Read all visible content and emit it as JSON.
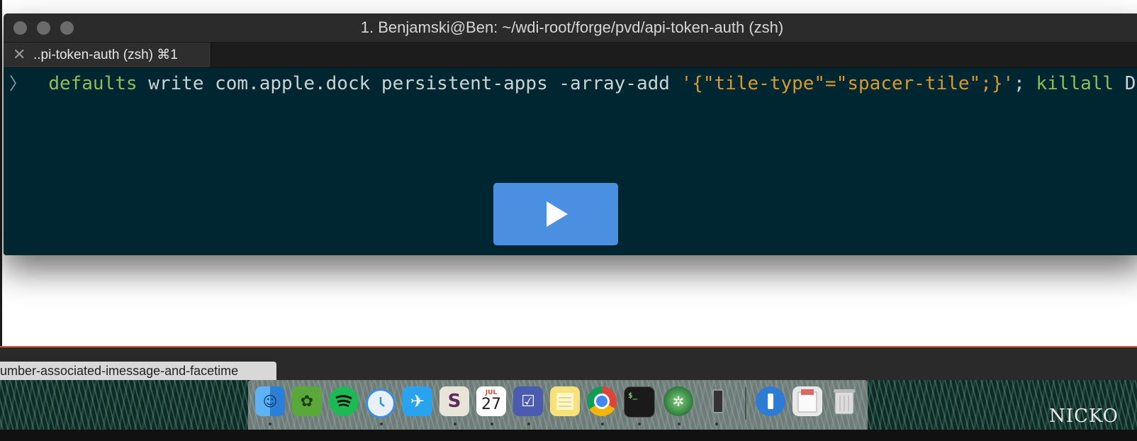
{
  "terminal": {
    "title": "1. Benjamski@Ben: ~/wdi-root/forge/pvd/api-token-auth (zsh)",
    "tab_label": "..pi-token-auth (zsh)  ⌘1",
    "tab_close": "✕",
    "prompt": "〉",
    "command": {
      "cmd": "defaults",
      "args": " write com.apple.dock persistent-apps -array-add ",
      "string": "'{\"tile-type\"=\"spacer-tile\";}'",
      "sep": "; ",
      "cmd2": "killall",
      "args2": " Dock"
    }
  },
  "video": {
    "play_icon": "play-icon"
  },
  "browser": {
    "tab_label": "umber-associated-imessage-and-facetime",
    "accent_color": "#e0553a"
  },
  "dock": {
    "apps": [
      "finder",
      "evernote",
      "spotify",
      "mail",
      "twitter",
      "slack",
      "calendar",
      "omnifocus",
      "notes",
      "chrome",
      "terminal",
      "photos",
      "simulator",
      "1password",
      "documents",
      "trash"
    ],
    "calendar_month": "JUL",
    "calendar_day": "27",
    "terminal_glyph": "$_"
  },
  "desktop": {
    "signature_text": "NICKO"
  },
  "colors": {
    "terminal_bg": "#002731",
    "command_green": "#8fbd57",
    "string_orange": "#d89a2a",
    "play_blue": "#4a8fe0"
  }
}
